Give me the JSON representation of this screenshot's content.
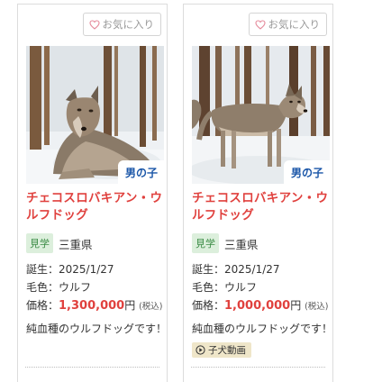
{
  "listings": [
    {
      "favorite_label": "お気に入り",
      "sex": "男の子",
      "breed": "チェコスロバキアン・ウルフドッグ",
      "visit_badge": "見学",
      "prefecture": "三重県",
      "birth_label": "誕生：",
      "birth": "2025/1/27",
      "color_label": "毛色：",
      "color": "ウルフ",
      "price_label": "価格：",
      "price": "1,300,000",
      "price_unit": "円",
      "tax": "(税込)",
      "description": "純血種のウルフドッグです！"
    },
    {
      "favorite_label": "お気に入り",
      "sex": "男の子",
      "breed": "チェコスロバキアン・ウルフドッグ",
      "visit_badge": "見学",
      "prefecture": "三重県",
      "birth_label": "誕生：",
      "birth": "2025/1/27",
      "color_label": "毛色：",
      "color": "ウルフ",
      "price_label": "価格：",
      "price": "1,000,000",
      "price_unit": "円",
      "tax": "(税込)",
      "description": "純血種のウルフドッグです！",
      "video_label": "子犬動画"
    }
  ],
  "colors": {
    "accent_red": "#e0413e",
    "sex_blue": "#1a56a8",
    "badge_green_bg": "#dcefdc",
    "badge_green_text": "#3c8c46",
    "video_bg": "#efe6c9",
    "heart_pink": "#e58a9b"
  },
  "icons": {
    "favorite": "heart-outline-icon",
    "video": "play-circle-icon"
  }
}
